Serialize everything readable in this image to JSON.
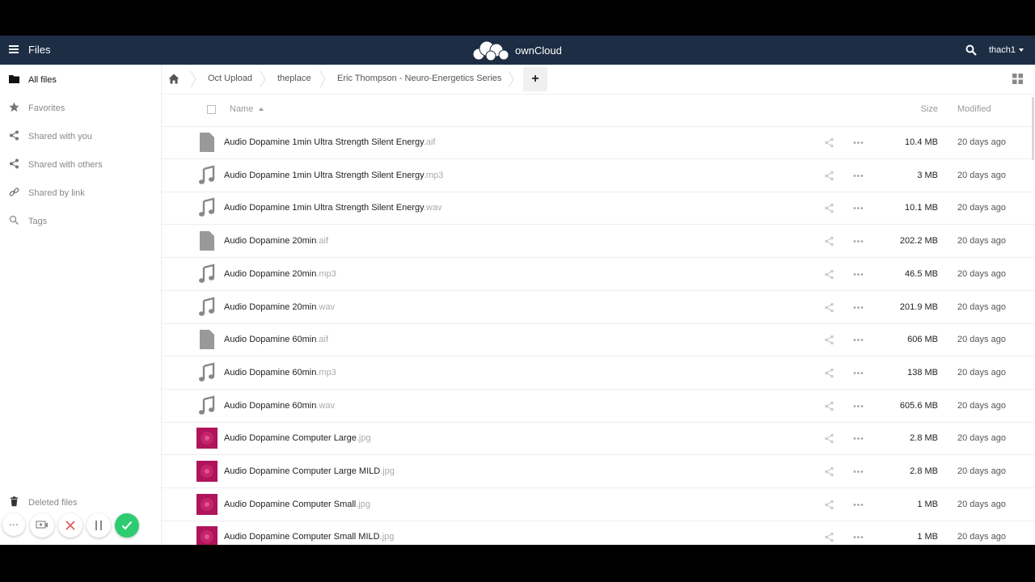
{
  "header": {
    "app_name": "Files",
    "logo_text": "ownCloud",
    "user": "thach1",
    "icons": [
      "menu-icon",
      "owncloud-logo-icon",
      "search-icon",
      "chevron-down-icon"
    ]
  },
  "sidebar": {
    "items": [
      {
        "label": "All files",
        "icon": "folder-icon",
        "active": true
      },
      {
        "label": "Favorites",
        "icon": "star-icon"
      },
      {
        "label": "Shared with you",
        "icon": "share-icon"
      },
      {
        "label": "Shared with others",
        "icon": "share-icon"
      },
      {
        "label": "Shared by link",
        "icon": "link-icon"
      },
      {
        "label": "Tags",
        "icon": "tag-icon"
      }
    ],
    "deleted": {
      "label": "Deleted files",
      "icon": "trash-icon"
    }
  },
  "breadcrumb": {
    "items": [
      "Oct Upload",
      "theplace",
      "Eric Thompson - Neuro-Energetics Series"
    ],
    "new_label": "+"
  },
  "table": {
    "columns": {
      "name": "Name",
      "size": "Size",
      "modified": "Modified"
    },
    "rows": [
      {
        "name": "Audio Dopamine 1min Ultra Strength Silent Energy",
        "ext": ".aif",
        "type": "file",
        "size": "10.4 MB",
        "modified": "20 days ago"
      },
      {
        "name": "Audio Dopamine 1min Ultra Strength Silent Energy",
        "ext": ".mp3",
        "type": "audio",
        "size": "3 MB",
        "modified": "20 days ago"
      },
      {
        "name": "Audio Dopamine 1min Ultra Strength Silent Energy",
        "ext": ".wav",
        "type": "audio",
        "size": "10.1 MB",
        "modified": "20 days ago"
      },
      {
        "name": "Audio Dopamine 20min",
        "ext": ".aif",
        "type": "file",
        "size": "202.2 MB",
        "modified": "20 days ago"
      },
      {
        "name": "Audio Dopamine 20min",
        "ext": ".mp3",
        "type": "audio",
        "size": "46.5 MB",
        "modified": "20 days ago"
      },
      {
        "name": "Audio Dopamine 20min",
        "ext": ".wav",
        "type": "audio",
        "size": "201.9 MB",
        "modified": "20 days ago"
      },
      {
        "name": "Audio Dopamine 60min",
        "ext": ".aif",
        "type": "file",
        "size": "606 MB",
        "modified": "20 days ago"
      },
      {
        "name": "Audio Dopamine 60min",
        "ext": ".mp3",
        "type": "audio",
        "size": "138 MB",
        "modified": "20 days ago"
      },
      {
        "name": "Audio Dopamine 60min",
        "ext": ".wav",
        "type": "audio",
        "size": "605.6 MB",
        "modified": "20 days ago"
      },
      {
        "name": "Audio Dopamine Computer Large",
        "ext": ".jpg",
        "type": "image",
        "size": "2.8 MB",
        "modified": "20 days ago"
      },
      {
        "name": "Audio Dopamine Computer Large MILD",
        "ext": ".jpg",
        "type": "image",
        "size": "2.8 MB",
        "modified": "20 days ago"
      },
      {
        "name": "Audio Dopamine Computer Small",
        "ext": ".jpg",
        "type": "image",
        "size": "1 MB",
        "modified": "20 days ago"
      },
      {
        "name": "Audio Dopamine Computer Small MILD",
        "ext": ".jpg",
        "type": "image",
        "size": "1 MB",
        "modified": "20 days ago"
      }
    ]
  },
  "controls": {
    "icons": [
      "more-icon",
      "screen-record-icon",
      "close-icon",
      "pause-icon",
      "checkmark-icon"
    ]
  },
  "colors": {
    "header_bg": "#1d2d44",
    "thumbnail": "#b0145a",
    "confirm": "#2ecc71",
    "cancel": "#e05555"
  }
}
